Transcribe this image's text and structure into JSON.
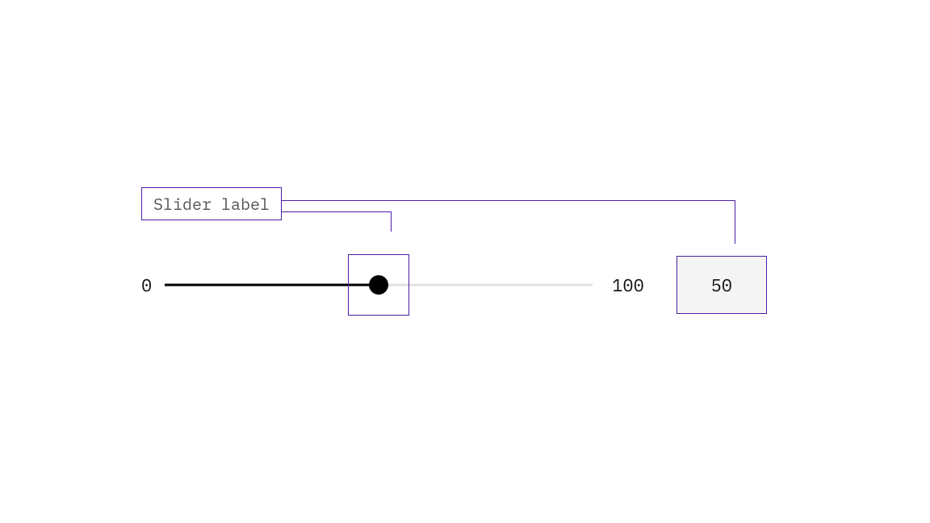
{
  "slider": {
    "label": "Slider label",
    "min": "0",
    "max": "100",
    "value": "50"
  }
}
